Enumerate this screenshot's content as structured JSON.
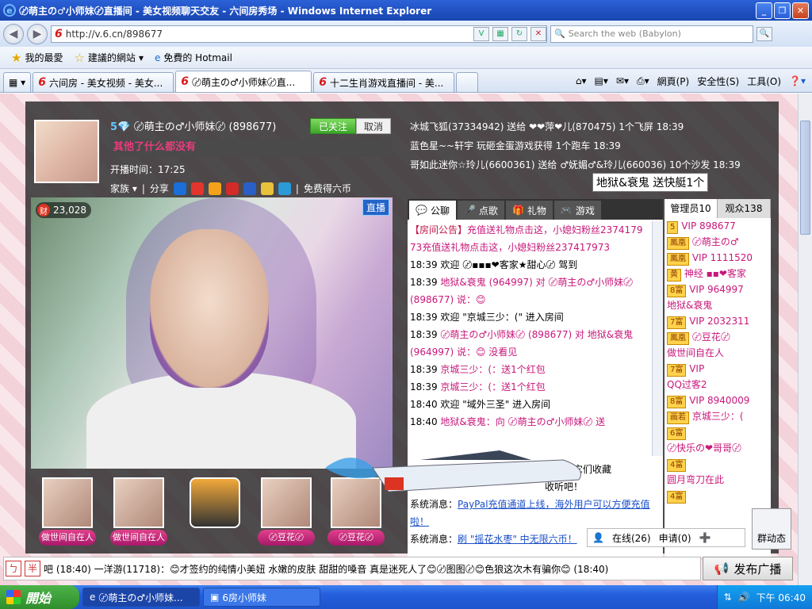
{
  "window": {
    "title": "〄萌主の♂小师妹〄直播间 - 美女视频聊天交友 - 六间房秀场 - Windows Internet Explorer"
  },
  "address": {
    "url": "http://v.6.cn/898677",
    "search_placeholder": "Search the web (Babylon)"
  },
  "favorites": {
    "favorites_label": "我的最愛",
    "suggested_sites": "建議的網站",
    "hotmail": "免費的 Hotmail"
  },
  "tabs": [
    {
      "label": "六间房 - 美女视频 - 美女..."
    },
    {
      "label": "〄萌主の♂小师妹〄直..."
    },
    {
      "label": "十二生肖游戏直播间 - 美..."
    }
  ],
  "toolbar": {
    "page": "網頁(P)",
    "safety": "安全性(S)",
    "tools": "工具(O)"
  },
  "host": {
    "name": "〄萌主の♂小师妹〄 (898677)",
    "followed_label": "已关注",
    "cancel_label": "取消",
    "motto": "其他了什么都没有",
    "start_time": "开播时间：17:25",
    "family_label": "家族",
    "share_label": "分享",
    "free_coins_label": "免费得六币",
    "fortune": "23,028",
    "fortune_icon": "财",
    "live_label": "直播"
  },
  "gift_feed": [
    {
      "text": "冰城飞狐(37334942) 送给 ❤❤萍❤儿(870475) 1个飞屏",
      "time": "18:39"
    },
    {
      "text": "蓝色星~~轩宇 玩砸金蛋游戏获得 1个跑车",
      "time": "18:39"
    },
    {
      "text": "哥如此迷你☆玲儿(6600361) 送给 ♂妩媚♂&玲儿(660036) 10个沙发",
      "time": "18:39"
    }
  ],
  "tooltip": "地狱&衰鬼 送快艇1个",
  "chat_tabs": [
    {
      "label": "公聊"
    },
    {
      "label": "点歌"
    },
    {
      "label": "礼物"
    },
    {
      "label": "游戏"
    }
  ],
  "chat": {
    "announcement_label": "【房间公告】",
    "announcement": "充值送礼物点击这，小媳妇粉丝2374179",
    "announcement2": "73充值送礼物点击这，小媳妇粉丝237417973",
    "lines": [
      {
        "time": "18:39",
        "text": "欢迎 〄▪▪▪❤客家★甜心〄 驾到"
      },
      {
        "time": "18:39",
        "text": "地狱&衰鬼 (964997) 对 〄萌主の♂小师妹〄 (898677) 说：😊"
      },
      {
        "time": "18:39",
        "text": "欢迎 \"京城三少：(\" 进入房间"
      },
      {
        "time": "18:39",
        "text": "〄萌主の♂小师妹〄 (898677) 对 地狱&衰鬼 (964997) 说：😊 没看见"
      },
      {
        "time": "18:39",
        "text": "京城三少：(：送1个红包"
      },
      {
        "time": "18:39",
        "text": "京城三少：(：送1个红包"
      },
      {
        "time": "18:40",
        "text": "欢迎 \"域外三圣\" 进入房间"
      },
      {
        "time": "18:40",
        "text": "地狱&衰鬼：向 〄萌主の♂小师妹〄 送"
      }
    ],
    "sys1_label": "系统消息：",
    "sys1": "PayPal充值通道上线，海外用户可以方便充值啦！",
    "sys2_label": "系统消息：",
    "sys2": "刷 \"摇花水枣\" 中无限六币！",
    "partial1": "么？把它们收藏",
    "partial2": "收听吧！"
  },
  "user_tabs": {
    "admins": "管理员10",
    "audience": "观众138"
  },
  "users": [
    {
      "badge": "5",
      "name": "VIP 898677"
    },
    {
      "badge": "鳳凰",
      "name": "〄萌主の♂"
    },
    {
      "badge": "鳳凰",
      "name": "VIP 1111520"
    },
    {
      "badge": "黄",
      "name": "神经 ▪▪❤客家"
    },
    {
      "badge": "8富",
      "name": "VIP 964997"
    },
    {
      "badge": "",
      "name": "地狱&衰鬼"
    },
    {
      "badge": "7富",
      "name": "VIP 2032311"
    },
    {
      "badge": "鳳凰",
      "name": "〄豆花〄"
    },
    {
      "badge": "",
      "name": "做世间自在人"
    },
    {
      "badge": "7富",
      "name": "VIP"
    },
    {
      "badge": "",
      "name": "QQ过客2"
    },
    {
      "badge": "8富",
      "name": "VIP 8940009"
    },
    {
      "badge": "画若",
      "name": "京城三少：("
    },
    {
      "badge": "6富",
      "name": ""
    },
    {
      "badge": "",
      "name": "〄快乐の❤哥哥〄"
    },
    {
      "badge": "4富",
      "name": ""
    },
    {
      "badge": "",
      "name": "圆月弯刀在此"
    },
    {
      "badge": "4富",
      "name": ""
    }
  ],
  "online_bar": {
    "online": "在线(26)",
    "apply": "申请(0)"
  },
  "dynamic_label": "群动态",
  "gallery": [
    {
      "label": "做世间自在人"
    },
    {
      "label": "做世间自在人"
    },
    {
      "label": ""
    },
    {
      "label": "〄豆花〄"
    },
    {
      "label": "〄豆花〄"
    }
  ],
  "input_bar": {
    "k1": "ㄅ",
    "k2": "半",
    "text": "吧 (18:40) 一洋游(11718)：😊才签约的纯情小美妞 水嫩的皮肤 甜甜的嗓音 真是迷死人了😊〄图图〄😊色狼这次木有骗你😊 (18:40)"
  },
  "broadcast_label": "发布广播",
  "taskbar": {
    "start": "開始",
    "tasks": [
      {
        "label": "〄萌主の♂小师妹..."
      },
      {
        "label": "6房小师妹"
      }
    ],
    "clock": "下午 06:40"
  }
}
